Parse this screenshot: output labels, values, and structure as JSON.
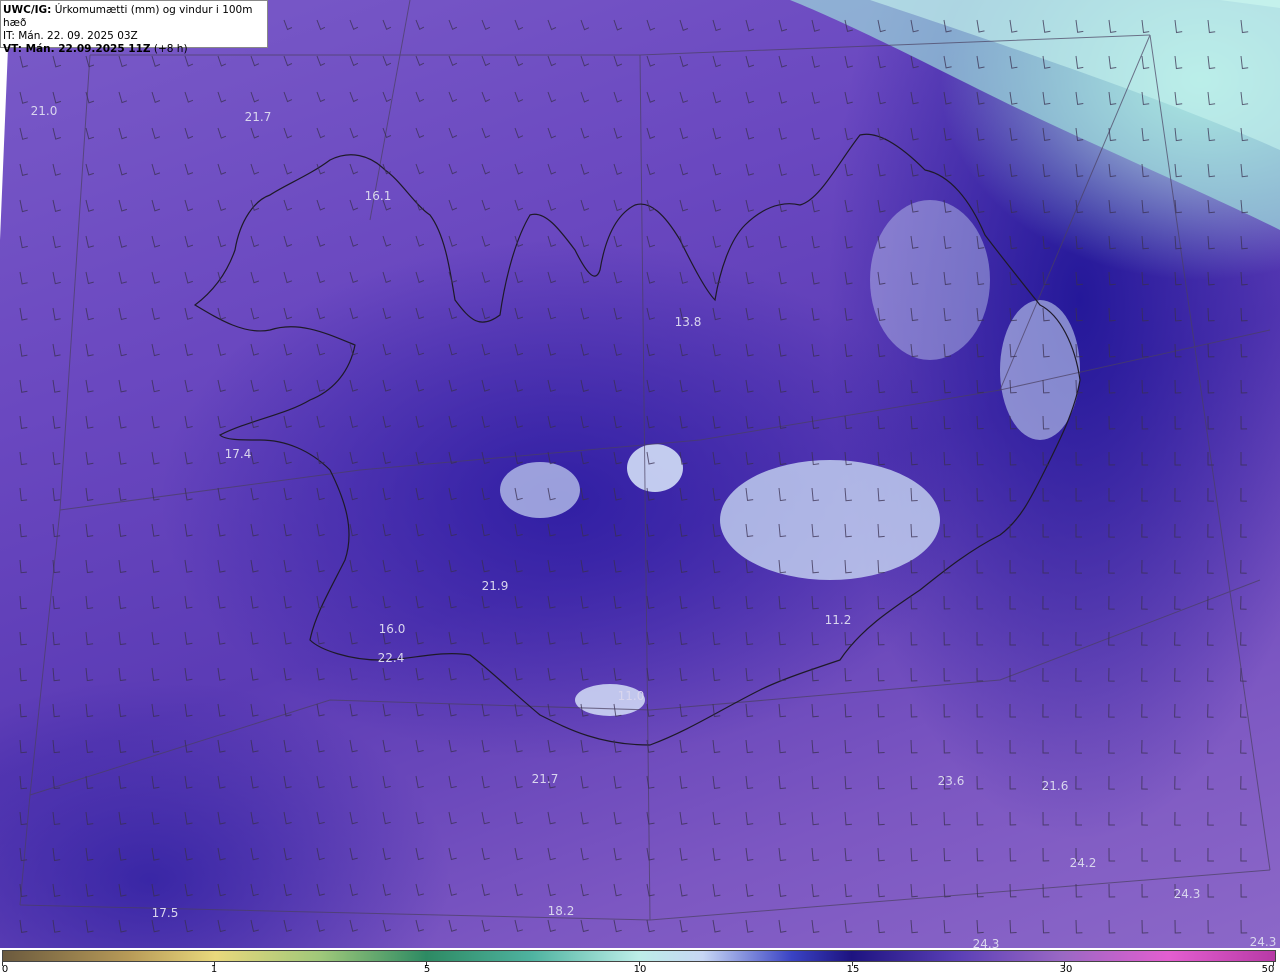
{
  "header": {
    "model": "UWC/IG:",
    "title": "Úrkomumætti (mm) og vindur i 100m hæð",
    "it_line": "IT: Mán. 22. 09. 2025 03Z",
    "vt_bold": "VT: Mán. 22.09.2025 11Z",
    "vt_offset": "(+8 h)"
  },
  "labels": [
    {
      "text": "21.0"
    },
    {
      "text": "21.7"
    },
    {
      "text": "16.1"
    },
    {
      "text": "13.8"
    },
    {
      "text": "17.4"
    },
    {
      "text": "21.9"
    },
    {
      "text": "16.0"
    },
    {
      "text": "22.4"
    },
    {
      "text": "11.2"
    },
    {
      "text": "11.0"
    },
    {
      "text": "21.7"
    },
    {
      "text": "23.6"
    },
    {
      "text": "21.6"
    },
    {
      "text": "24.2"
    },
    {
      "text": "24.3"
    },
    {
      "text": "17.5"
    },
    {
      "text": "18.2"
    },
    {
      "text": "24.3"
    },
    {
      "text": "24.3"
    }
  ],
  "colorbar": {
    "ticks": [
      "0",
      "1",
      "5",
      "10",
      "15",
      "30",
      "50"
    ],
    "colors": {
      "low": "#6b5a3e",
      "mid": "#bdeee8",
      "dark": "#1d1380",
      "high": "#b83aa6"
    }
  }
}
